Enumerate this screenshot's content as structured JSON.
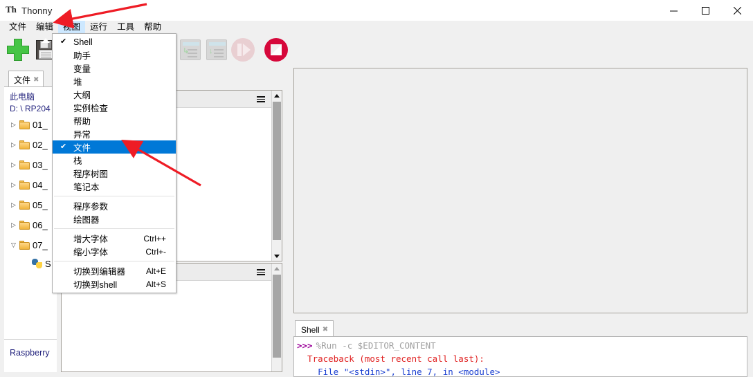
{
  "window": {
    "title": "Thonny",
    "app_icon": "thonny-icon",
    "controls": {
      "minimize": "minimize-icon",
      "maximize": "maximize-icon",
      "close": "close-icon"
    }
  },
  "menubar": {
    "items": [
      {
        "label": "文件",
        "active": false
      },
      {
        "label": "编辑",
        "active": false
      },
      {
        "label": "视图",
        "active": true
      },
      {
        "label": "运行",
        "active": false
      },
      {
        "label": "工具",
        "active": false
      },
      {
        "label": "帮助",
        "active": false
      }
    ]
  },
  "toolbar": {
    "buttons": [
      {
        "name": "new-file-button",
        "icon": "plus-icon",
        "enabled": true
      },
      {
        "name": "save-button",
        "icon": "save-floppy-icon",
        "enabled": true
      },
      {
        "name": "step-over-button",
        "icon": "step-over-icon",
        "enabled": false
      },
      {
        "name": "step-into-button",
        "icon": "step-into-icon",
        "enabled": false
      },
      {
        "name": "resume-button",
        "icon": "resume-icon",
        "enabled": false
      },
      {
        "name": "stop-button",
        "icon": "stop-icon",
        "enabled": true
      }
    ]
  },
  "view_menu": {
    "groups": [
      {
        "items": [
          {
            "label": "Shell",
            "checked": true,
            "selected": false,
            "accel": ""
          },
          {
            "label": "助手",
            "checked": false,
            "selected": false,
            "accel": ""
          },
          {
            "label": "变量",
            "checked": false,
            "selected": false,
            "accel": ""
          },
          {
            "label": "堆",
            "checked": false,
            "selected": false,
            "accel": ""
          },
          {
            "label": "大纲",
            "checked": false,
            "selected": false,
            "accel": ""
          },
          {
            "label": "实例检查",
            "checked": false,
            "selected": false,
            "accel": ""
          },
          {
            "label": "帮助",
            "checked": false,
            "selected": false,
            "accel": ""
          },
          {
            "label": "异常",
            "checked": false,
            "selected": false,
            "accel": ""
          },
          {
            "label": "文件",
            "checked": true,
            "selected": true,
            "accel": ""
          },
          {
            "label": "栈",
            "checked": false,
            "selected": false,
            "accel": ""
          },
          {
            "label": "程序树图",
            "checked": false,
            "selected": false,
            "accel": ""
          },
          {
            "label": "笔记本",
            "checked": false,
            "selected": false,
            "accel": ""
          }
        ]
      },
      {
        "items": [
          {
            "label": "程序参数",
            "checked": false,
            "selected": false,
            "accel": ""
          },
          {
            "label": "绘图器",
            "checked": false,
            "selected": false,
            "accel": ""
          }
        ]
      },
      {
        "items": [
          {
            "label": "增大字体",
            "checked": false,
            "selected": false,
            "accel": "Ctrl++"
          },
          {
            "label": "缩小字体",
            "checked": false,
            "selected": false,
            "accel": "Ctrl+-"
          }
        ]
      },
      {
        "items": [
          {
            "label": "切换到编辑器",
            "checked": false,
            "selected": false,
            "accel": "Alt+E"
          },
          {
            "label": "切换到shell",
            "checked": false,
            "selected": false,
            "accel": "Alt+S"
          }
        ]
      }
    ]
  },
  "files_pane": {
    "tab_label": "文件",
    "tab_close": "✖",
    "this_computer": "此电脑",
    "path": "D: \\ RP204",
    "tree": [
      {
        "label": "01_",
        "type": "folder",
        "expanded": false
      },
      {
        "label": "02_",
        "type": "folder",
        "expanded": false
      },
      {
        "label": "03_",
        "type": "folder",
        "expanded": false
      },
      {
        "label": "04_",
        "type": "folder",
        "expanded": false
      },
      {
        "label": "05_",
        "type": "folder",
        "expanded": false
      },
      {
        "label": "06_",
        "type": "folder",
        "expanded": false
      },
      {
        "label": "07_",
        "type": "folder",
        "expanded": true
      },
      {
        "label": "S",
        "type": "python-file",
        "expanded": false
      }
    ],
    "footer_label": "Raspberry"
  },
  "shell": {
    "tab_label": "Shell",
    "tab_close": "✖",
    "prompt": ">>>",
    "command": "%Run -c $EDITOR_CONTENT",
    "traceback_line": "  Traceback (most recent call last):",
    "file_line": "    File \"<stdin>\", line 7, in <module>"
  },
  "colors": {
    "menu_highlight": "#0078d7",
    "menubar_active": "#cde8ff",
    "stop_button": "#d6083b",
    "link_text": "#26267f",
    "error_text": "#e02020",
    "prompt_text": "#9b0099",
    "annotation_arrow": "#ee1c25"
  },
  "annotations": [
    {
      "name": "arrow-to-view-menu",
      "target": "视图"
    },
    {
      "name": "arrow-to-files-item",
      "target": "文件"
    }
  ]
}
